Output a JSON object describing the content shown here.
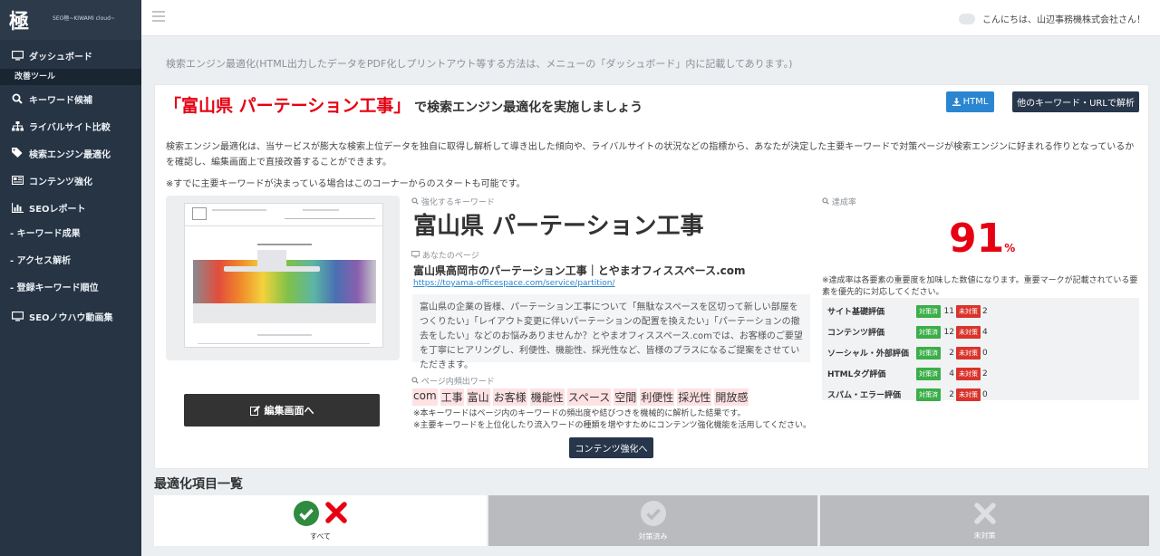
{
  "sidebar": {
    "logo": "極",
    "logo_sub": "SEO極~KIWAMI cloud~",
    "items": [
      {
        "label": "ダッシュボード"
      },
      {
        "header": "改善ツール"
      },
      {
        "label": "キーワード候補"
      },
      {
        "label": "ライバルサイト比較"
      },
      {
        "label": "検索エンジン最適化"
      },
      {
        "label": "コンテンツ強化"
      },
      {
        "label": "SEOレポート"
      },
      {
        "label": "- キーワード成果"
      },
      {
        "label": "- アクセス解析"
      },
      {
        "label": "- 登録キーワード順位"
      },
      {
        "label": "SEOノウハウ動画集"
      }
    ]
  },
  "topbar": {
    "greeting": "こんにちは、山辺事務機株式会社さん！"
  },
  "notice": "検索エンジン最適化(HTML出力したデータをPDF化しプリントアウト等する方法は、メニューの「ダッシュボード」内に記載してあります。)",
  "panel": {
    "headline_keyword": "「富山県 パーテーション工事」",
    "headline_rest": "で検索エンジン最適化を実施しましょう",
    "btn_html": "HTML",
    "btn_other": "他のキーワード・URLで解析",
    "description": "検索エンジン最適化は、当サービスが膨大な検索上位データを独自に取得し解析して導き出した傾向や、ライバルサイトの状況などの指標から、あなたが決定した主要キーワードで対策ページが検索エンジンに好まれる作りとなっているかを確認し、編集画面上で直接改善することができます。",
    "note": "※すでに主要キーワードが決まっている場合はこのコーナーからのスタートも可能です。",
    "edit_button": "編集画面へ",
    "keyword_label": "強化するキーワード",
    "keyword": "富山県 パーテーション工事",
    "page_label": "あなたのページ",
    "page_title": "富山県高岡市のパーテーション工事｜とやまオフィススペース.com",
    "page_url": "https://toyama-officespace.com/service/partition/",
    "page_desc": "富山県の企業の皆様、パーテーション工事について「無駄なスペースを区切って新しい部屋をつくりたい」「レイアウト変更に伴いパーテーションの配置を換えたい」「パーテーションの撤去をしたい」などのお悩みありませんか？とやまオフィススペース.comでは、お客様のご要望を丁寧にヒアリングし、利便性、機能性、採光性など、皆様のプラスになるご提案をさせていただきます。",
    "freq_label": "ページ内頻出ワード",
    "freq_words": [
      "com",
      "工事",
      "富山",
      "お客様",
      "機能性",
      "スペース",
      "空間",
      "利便性",
      "採光性",
      "開放感"
    ],
    "freq_note1": "※本キーワードはページ内のキーワードの頻出度や結びつきを機械的に解析した結果です。",
    "freq_note2": "※主要キーワードを上位化したり流入ワードの種類を増やすためにコンテンツ強化機能を活用してください。",
    "content_button": "コンテンツ強化へ",
    "rate_label": "達成率",
    "rate_value": "91",
    "rate_unit": "%",
    "rate_note": "※達成率は各要素の重要度を加味した数値になります。重要マークが記載されている要素を優先的に対応してください。",
    "tag_done": "対策済",
    "tag_todo": "未対策",
    "scores": [
      {
        "name": "サイト基礎評価",
        "done": "11",
        "todo": "2"
      },
      {
        "name": "コンテンツ評価",
        "done": "12",
        "todo": "4"
      },
      {
        "name": "ソーシャル・外部評価",
        "done": "2",
        "todo": "0"
      },
      {
        "name": "HTMLタグ評価",
        "done": "4",
        "todo": "2"
      },
      {
        "name": "スパム・エラー評価",
        "done": "2",
        "todo": "0"
      }
    ]
  },
  "list": {
    "title": "最適化項目一覧",
    "filters": [
      {
        "label": "すべて"
      },
      {
        "label": "対策済み"
      },
      {
        "label": "未対策"
      }
    ]
  },
  "colors": {
    "accent_red": "#e60012",
    "navy": "#27364a",
    "blue": "#2a86d1",
    "green": "#3bae49"
  }
}
